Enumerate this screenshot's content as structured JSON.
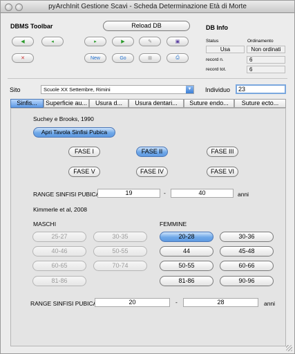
{
  "window": {
    "title": "pyArchInit Gestione Scavi - Scheda Determinazione Età di Morte"
  },
  "toolbar": {
    "title": "DBMS Toolbar",
    "reload_label": "Reload DB",
    "icons": [
      "first-icon",
      "prev-icon",
      "next-icon",
      "last-icon",
      "new-icon",
      "save-icon",
      "delete-icon",
      "new-record-icon",
      "search-icon",
      "go-icon",
      "view-icon",
      "print-icon"
    ],
    "new_label": "New",
    "go_label": "Go"
  },
  "dbinfo": {
    "title": "DB Info",
    "status_label": "Status",
    "status_value": "Usa",
    "order_label": "Ordinamento",
    "order_value": "Non ordinati",
    "record_n_label": "record n.",
    "record_n_value": "6",
    "record_tot_label": "record tot.",
    "record_tot_value": "6"
  },
  "form": {
    "sito_label": "Sito",
    "sito_value": "Scuole XX Settembre, Rimini",
    "individuo_label": "Individuo",
    "individuo_value": "23"
  },
  "tabs": [
    "Sinfis...",
    "Superficie au...",
    "Usura d...",
    "Usura dentari...",
    "Suture endo...",
    "Suture ecto..."
  ],
  "suchey": {
    "heading": "Suchey e Brooks,  1990",
    "open_button": "Apri Tavola Sinfisi Pubica",
    "fasi": [
      "FASE I",
      "FASE II",
      "FASE III",
      "FASE V",
      "FASE IV",
      "FASE VI"
    ],
    "range_label": "RANGE SINFISI PUBICA",
    "range_min": "19",
    "range_dash": "-",
    "range_max": "40",
    "unit": "anni"
  },
  "kimmerle": {
    "heading": "Kimmerle et al, 2008",
    "maschi_label": "MASCHI",
    "femmine_label": "FEMMINE",
    "maschi": [
      "25-27",
      "30-35",
      "40-46",
      "50-55",
      "60-65",
      "70-74",
      "81-86"
    ],
    "femmine": [
      "20-28",
      "30-36",
      "44",
      "45-48",
      "50-55",
      "60-66",
      "81-86",
      "90-96"
    ],
    "range_label": "RANGE SINFISI PUBICA",
    "range_min": "20",
    "range_dash": "-",
    "range_max": "28",
    "unit": "anni"
  },
  "colors": {
    "selected": "#6fa8e8",
    "accent": "#1e6fcf"
  }
}
